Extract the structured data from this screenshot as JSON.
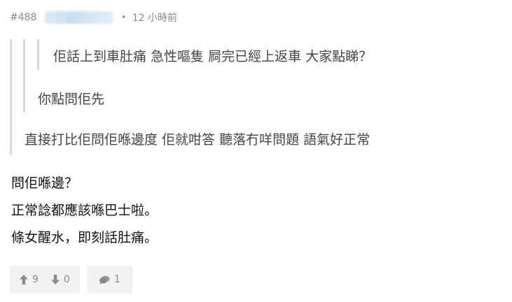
{
  "post": {
    "floor": "#488",
    "dot": "•",
    "time": "12 小時前"
  },
  "quotes": {
    "inner": "佢話上到車肚痛 急性嘔隻 屙完已經上返車 大家點睇？",
    "middle": "你點問佢先",
    "outer": "直接打比佢問佢喺邊度 佢就咁答 聽落冇咩問題 語氣好正常"
  },
  "body": {
    "lines": [
      "問佢喺邊？",
      "正常諗都應該喺巴士啦。",
      "條女醒水，即刻話肚痛。"
    ]
  },
  "actions": {
    "upvotes": "9",
    "downvotes": "0",
    "replies": "1",
    "icons": {
      "up": "arrow-up-icon",
      "down": "arrow-down-icon",
      "reply": "speech-bubble-icon"
    }
  },
  "colors": {
    "meta_text": "#8a8a8a",
    "quote_bar": "#d9d9d9",
    "button_bg": "#f2f2f2"
  }
}
